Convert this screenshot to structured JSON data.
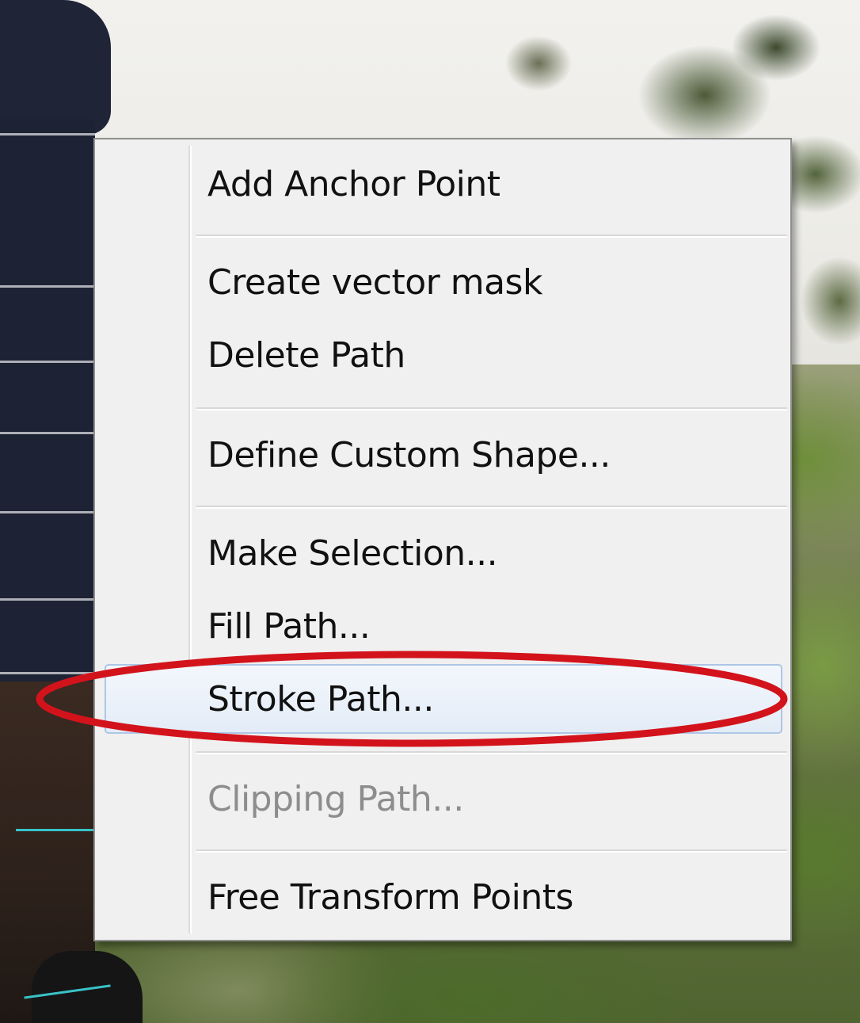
{
  "menu": {
    "items": [
      {
        "label": "Add Anchor Point",
        "enabled": true
      },
      {
        "label": "Create vector mask",
        "enabled": true
      },
      {
        "label": "Delete Path",
        "enabled": true
      },
      {
        "label": "Define Custom Shape...",
        "enabled": true
      },
      {
        "label": "Make Selection...",
        "enabled": true
      },
      {
        "label": "Fill Path...",
        "enabled": true
      },
      {
        "label": "Stroke Path...",
        "enabled": true,
        "highlighted": true
      },
      {
        "label": "Clipping Path...",
        "enabled": false
      },
      {
        "label": "Free Transform Points",
        "enabled": true
      }
    ]
  },
  "colors": {
    "menu_background": "#f0f0f0",
    "highlight_border": "#aec6e6",
    "annotation_circle": "#d3131b",
    "disabled_text": "#8d8d8d"
  }
}
